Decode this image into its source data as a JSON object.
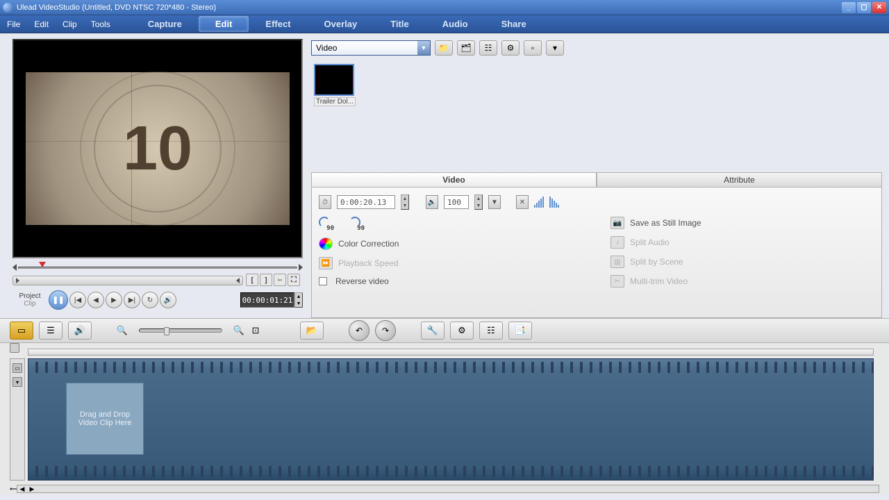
{
  "window": {
    "title": "Ulead VideoStudio (Untitled, DVD NTSC 720*480 - Stereo)"
  },
  "menus": {
    "file": "File",
    "edit": "Edit",
    "clip": "Clip",
    "tools": "Tools"
  },
  "steps": {
    "capture": "Capture",
    "edit": "Edit",
    "effect": "Effect",
    "overlay": "Overlay",
    "title": "Title",
    "audio": "Audio",
    "share": "Share"
  },
  "preview": {
    "countdown": "10"
  },
  "transport": {
    "mode_project": "Project",
    "mode_clip": "Clip",
    "timecode": "00:00:01:21",
    "mark_in": "[",
    "mark_out": "]"
  },
  "library": {
    "category": "Video",
    "thumb1": "Trailer Dol..."
  },
  "options_tabs": {
    "video": "Video",
    "attribute": "Attribute"
  },
  "options": {
    "duration": "0:00:20.13",
    "volume": "100",
    "rotate_deg": "90",
    "save_still": "Save as Still Image",
    "color_correction": "Color Correction",
    "playback_speed": "Playback Speed",
    "reverse_video": "Reverse video",
    "split_audio": "Split Audio",
    "split_scene": "Split by Scene",
    "multitrim": "Multi-trim Video"
  },
  "timeline": {
    "drop_hint": "Drag and Drop Video Clip Here"
  }
}
